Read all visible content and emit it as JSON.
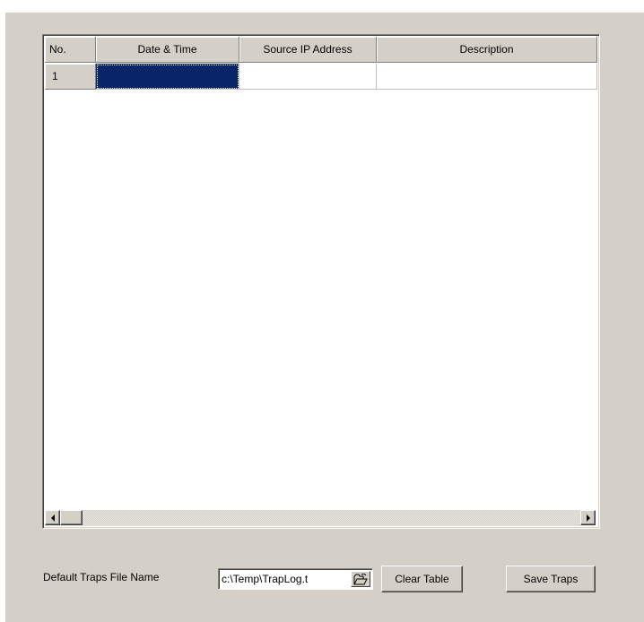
{
  "table": {
    "columns": [
      "No.",
      "Date & Time",
      "Source IP Address",
      "Description"
    ],
    "rows": [
      {
        "no": "1",
        "date_time": "",
        "source_ip": "",
        "description": ""
      }
    ]
  },
  "footer": {
    "file_label": "Default Traps File Name",
    "file_value": "c:\\Temp\\TrapLog.t",
    "clear_label": "Clear Table",
    "save_label": "Save Traps"
  },
  "icons": {
    "browse": "open-folder-icon",
    "scroll_left": "arrow-left-icon",
    "scroll_right": "arrow-right-icon"
  },
  "colors": {
    "selection": "#0a246a",
    "panel": "#d4d0c8"
  }
}
